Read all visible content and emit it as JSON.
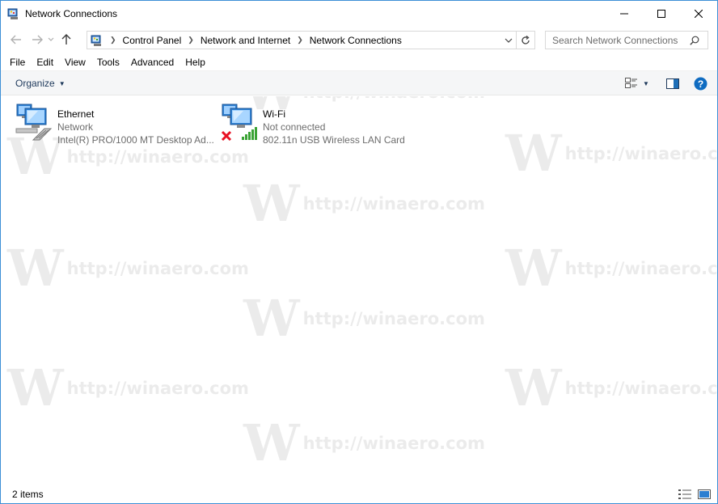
{
  "window": {
    "title": "Network Connections",
    "minimize_icon": "minimize-icon",
    "maximize_icon": "maximize-icon",
    "close_icon": "close-icon"
  },
  "address": {
    "breadcrumbs": [
      "Control Panel",
      "Network and Internet",
      "Network Connections"
    ],
    "search_placeholder": "Search Network Connections"
  },
  "menu": {
    "items": [
      "File",
      "Edit",
      "View",
      "Tools",
      "Advanced",
      "Help"
    ]
  },
  "command_bar": {
    "organize_label": "Organize"
  },
  "connections": [
    {
      "name": "Ethernet",
      "status": "Network",
      "device": "Intel(R) PRO/1000 MT Desktop Ad..."
    },
    {
      "name": "Wi-Fi",
      "status": "Not connected",
      "device": "802.11n USB Wireless LAN Card"
    }
  ],
  "watermark": {
    "logo": "W",
    "text": "http://winaero.com"
  },
  "status_bar": {
    "item_count": "2 items"
  },
  "colors": {
    "accent": "#1979ca",
    "window_border": "#3c8fd6",
    "help_blue": "#0f6cc1",
    "error_red": "#e81123",
    "signal_green": "#3aa335"
  }
}
